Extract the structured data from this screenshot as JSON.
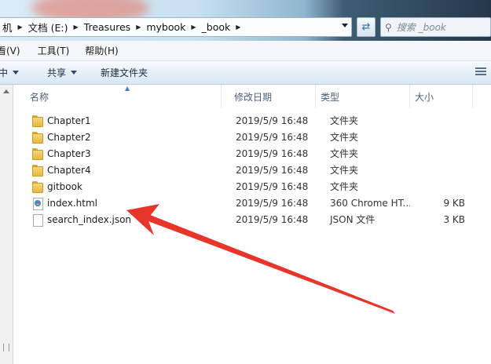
{
  "address": {
    "crumbs": [
      "机",
      "文档 (E:)",
      "Treasures",
      "mybook",
      "_book"
    ],
    "search_placeholder": "搜索 _book"
  },
  "menu": [
    "看(V)",
    "工具(T)",
    "帮助(H)"
  ],
  "commands": {
    "left_partial": "中",
    "share": "共享",
    "new_folder": "新建文件夹"
  },
  "columns": {
    "name": "名称",
    "date": "修改日期",
    "type": "类型",
    "size": "大小"
  },
  "files": [
    {
      "name": "Chapter1",
      "date": "2019/5/9 16:48",
      "type": "文件夹",
      "size": "",
      "icon": "folder-icon"
    },
    {
      "name": "Chapter2",
      "date": "2019/5/9 16:48",
      "type": "文件夹",
      "size": "",
      "icon": "folder-icon"
    },
    {
      "name": "Chapter3",
      "date": "2019/5/9 16:48",
      "type": "文件夹",
      "size": "",
      "icon": "folder-icon"
    },
    {
      "name": "Chapter4",
      "date": "2019/5/9 16:48",
      "type": "文件夹",
      "size": "",
      "icon": "folder-icon"
    },
    {
      "name": "gitbook",
      "date": "2019/5/9 16:48",
      "type": "文件夹",
      "size": "",
      "icon": "folder-icon"
    },
    {
      "name": "index.html",
      "date": "2019/5/9 16:48",
      "type": "360 Chrome HT...",
      "size": "9 KB",
      "icon": "html-file-icon"
    },
    {
      "name": "search_index.json",
      "date": "2019/5/9 16:48",
      "type": "JSON 文件",
      "size": "3 KB",
      "icon": "json-file-icon"
    }
  ],
  "colors": {
    "annotation_arrow": "#e8352a",
    "folder": "#e7b640",
    "header_text": "#4c607a"
  }
}
